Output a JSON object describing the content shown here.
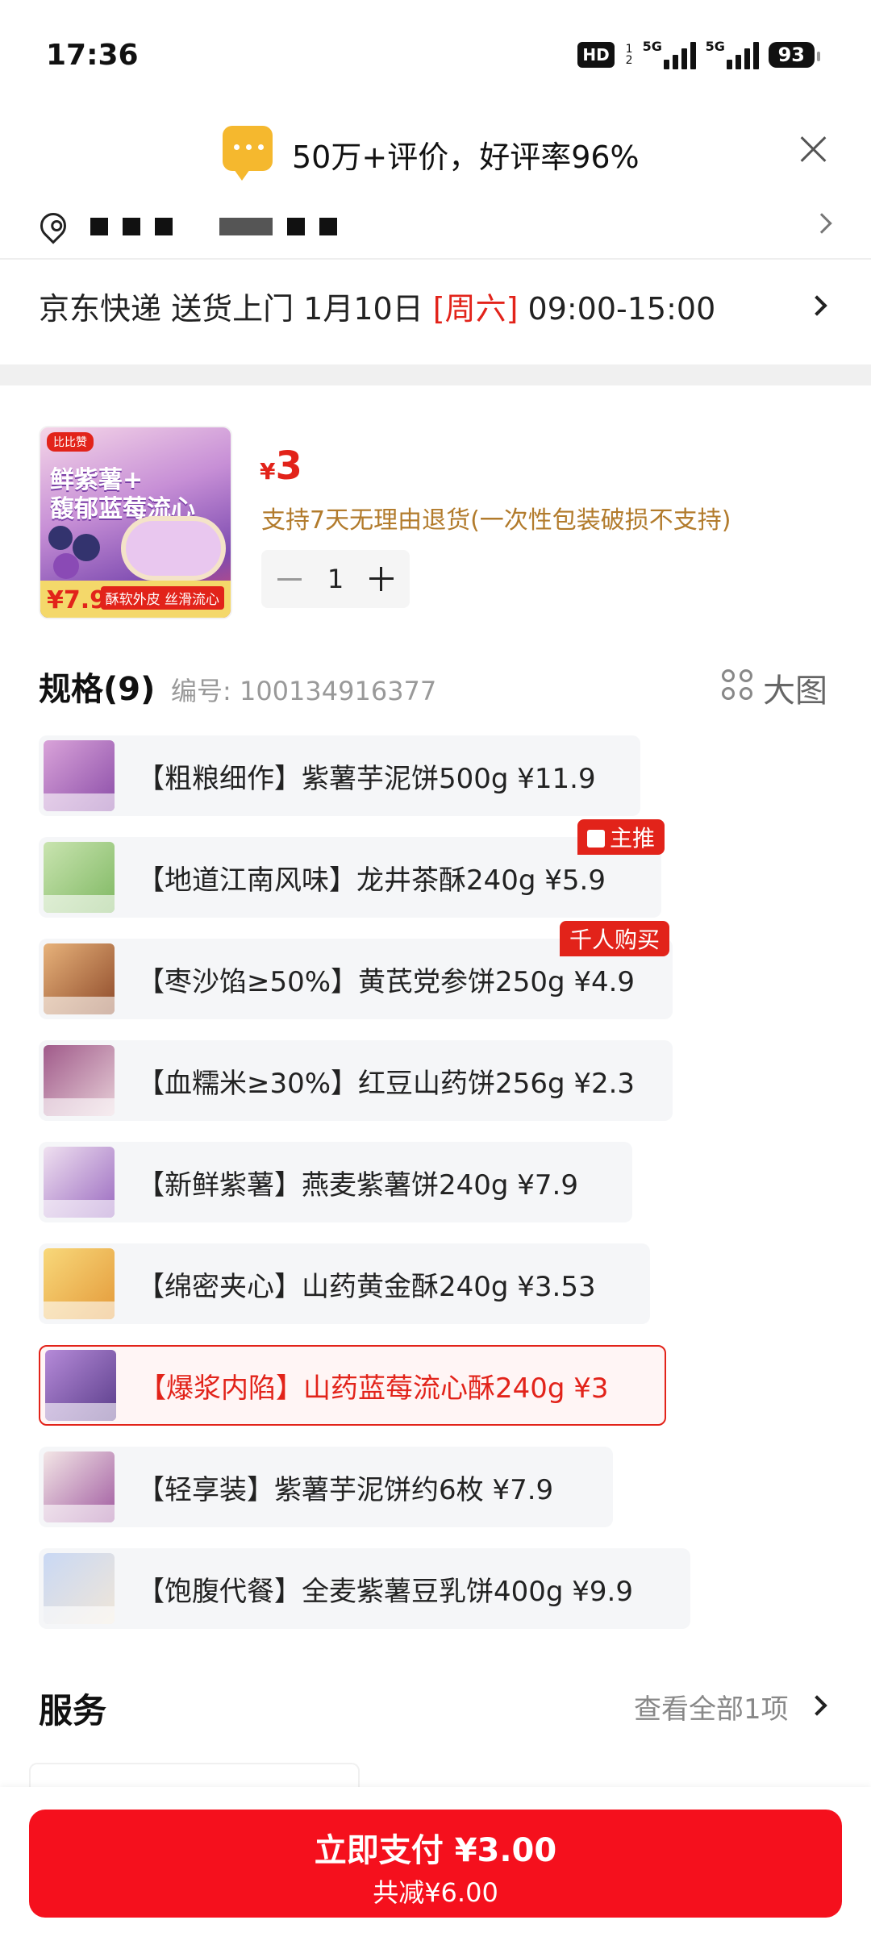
{
  "status_bar": {
    "time": "17:36",
    "hd": "HD",
    "hd_sub_top": "1",
    "hd_sub_bottom": "2",
    "net1": "5G",
    "net2": "5G",
    "battery": "93"
  },
  "review": {
    "text": "50万+评价，好评率96%"
  },
  "delivery": {
    "prefix": "京东快递 送货上门 1月10日 ",
    "weekday": "[周六]",
    "time_range": " 09:00-15:00"
  },
  "product": {
    "thumb_brand": "比比赞",
    "thumb_title1": "鲜紫薯+",
    "thumb_title2": "馥郁蓝莓流心",
    "thumb_price": "¥7.9",
    "thumb_slogan": "酥软外皮 丝滑流心",
    "currency": "¥",
    "price": "3",
    "return_policy": "支持7天无理由退货(一次性包装破损不支持)",
    "quantity": "1"
  },
  "spec": {
    "title": "规格(9)",
    "code": "编号: 100134916377",
    "big_image": "大图",
    "items": [
      {
        "label": "【粗粮细作】紫薯芋泥饼500g  ¥11.9"
      },
      {
        "label": "【地道江南风味】龙井茶酥240g  ¥5.9",
        "badge": "主推"
      },
      {
        "label": "【枣沙馅≥50%】黄芪党参饼250g  ¥4.9",
        "badge": "千人购买"
      },
      {
        "label": "【血糯米≥30%】红豆山药饼256g  ¥2.3"
      },
      {
        "label": "【新鲜紫薯】燕麦紫薯饼240g  ¥7.9"
      },
      {
        "label": "【绵密夹心】山药黄金酥240g  ¥3.53"
      },
      {
        "label": "【爆浆内陷】山药蓝莓流心酥240g  ¥3"
      },
      {
        "label": "【轻享装】紫薯芋泥饼约6枚  ¥7.9"
      },
      {
        "label": "【饱腹代餐】全麦紫薯豆乳饼400g  ¥9.9"
      }
    ]
  },
  "services": {
    "title": "服务",
    "view_all": "查看全部1项"
  },
  "pay": {
    "main": "立即支付 ¥3.00",
    "sub": "共减¥6.00"
  },
  "colors": {
    "accent": "#e2231a",
    "pay_button": "#f5101d",
    "policy": "#b27b2c"
  }
}
